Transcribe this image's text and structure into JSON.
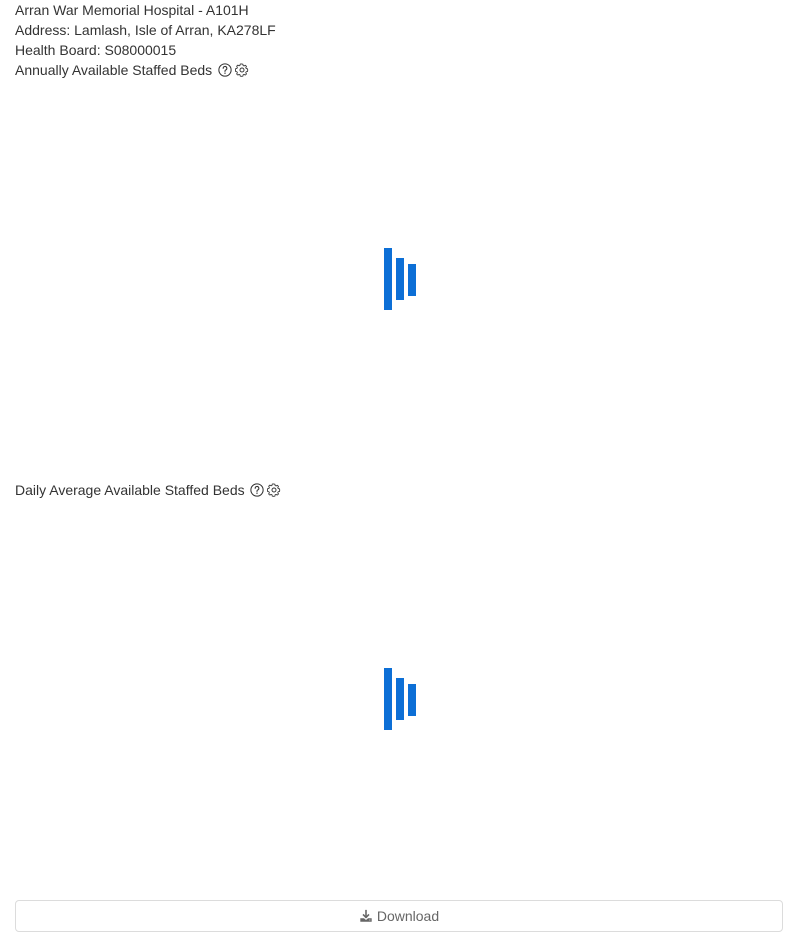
{
  "hospital": {
    "name_line": "Arran War Memorial Hospital - A101H",
    "address_line": "Address: Lamlash, Isle of Arran, KA278LF",
    "health_board_line": "Health Board: S08000015"
  },
  "sections": [
    {
      "title": "Annually Available Staffed Beds",
      "help_icon": "question-circle-icon",
      "settings_icon": "gear-icon",
      "loading_icon": "loading-bars-icon"
    },
    {
      "title": "Daily Average Available Staffed Beds",
      "help_icon": "question-circle-icon",
      "settings_icon": "gear-icon",
      "loading_icon": "loading-bars-icon"
    }
  ],
  "download": {
    "label": "Download",
    "icon": "download-icon"
  },
  "colors": {
    "loader": "#0d6fd6",
    "text": "#333333",
    "button_text": "#666666"
  }
}
